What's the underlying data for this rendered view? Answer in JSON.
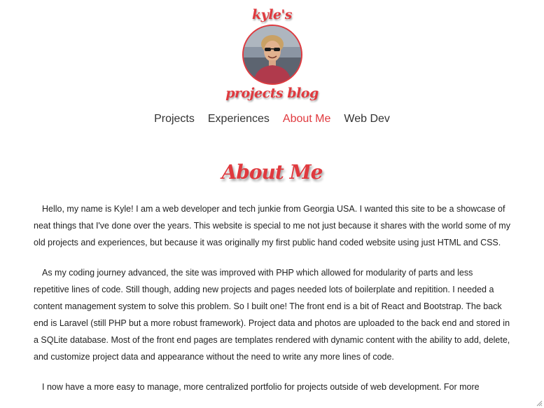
{
  "header": {
    "brand_top": "kyle's",
    "brand_bottom": "projects blog"
  },
  "nav": {
    "items": [
      {
        "label": "Projects"
      },
      {
        "label": "Experiences"
      },
      {
        "label": "About Me"
      },
      {
        "label": "Web Dev"
      }
    ],
    "active": "About Me"
  },
  "main": {
    "title": "About Me",
    "paragraphs": [
      "Hello, my name is Kyle! I am a web developer and tech junkie from Georgia USA. I wanted this site to be a showcase of neat things that I've done over the years. This website is special to me not just because it shares with the world some of my old projects and experiences, but because it was originally my first public hand coded website using just HTML and CSS.",
      "As my coding journey advanced, the site was improved with PHP which allowed for modularity of parts and less repetitive lines of code. Still though, adding new projects and pages needed lots of boilerplate and repitition. I needed a content management system to solve this problem. So I built one! The front end is a bit of React and Bootstrap. The back end is Laravel (still PHP but a more robust framework). Project data and photos are uploaded to the back end and stored in a SQLite database. Most of the front end pages are templates rendered with dynamic content with the ability to add, delete, and customize project data and appearance without the need to write any more lines of code.",
      "I now have a more easy to manage, more centralized portfolio for projects outside of web development. For more"
    ]
  },
  "colors": {
    "accent": "#e0393e",
    "text": "#222222"
  },
  "icons": {
    "resize_grip": "resize-grip-icon"
  }
}
